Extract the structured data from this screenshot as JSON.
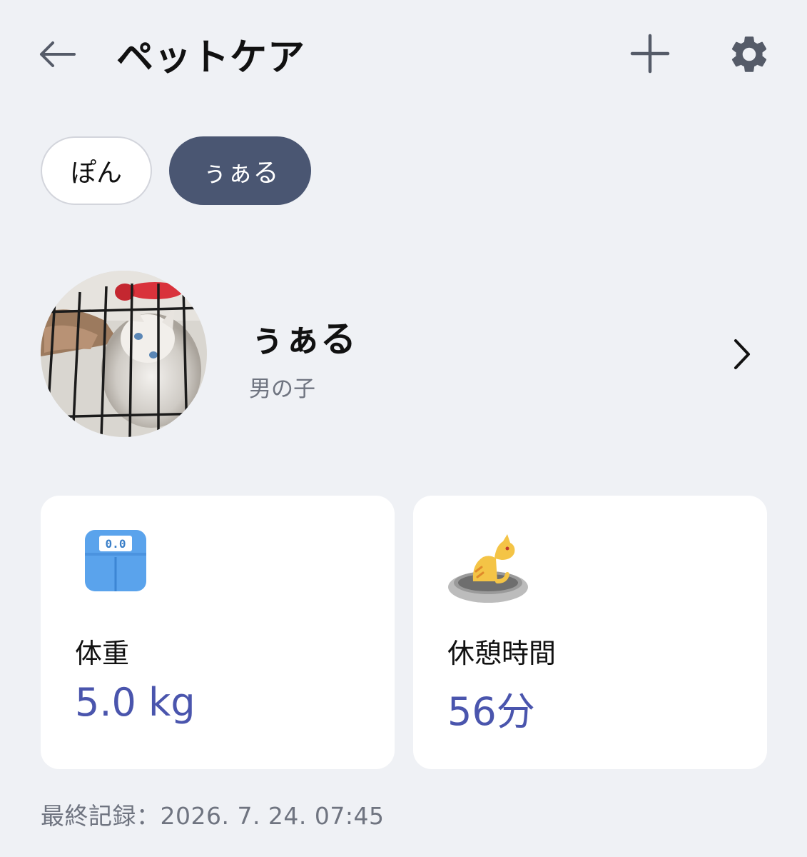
{
  "header": {
    "title": "ペットケア",
    "back_icon": "arrow-left-icon",
    "add_icon": "plus-icon",
    "settings_icon": "gear-icon"
  },
  "pet_tabs": [
    {
      "label": "ぽん",
      "selected": false
    },
    {
      "label": "ぅぁる",
      "selected": true
    }
  ],
  "profile": {
    "name": "ぅぁる",
    "sex": "男の子",
    "photo": "kitten-behind-cage-photo",
    "chevron_icon": "chevron-right-icon"
  },
  "cards": {
    "weight": {
      "icon": "scale-icon",
      "label": "体重",
      "value": "5.0 kg"
    },
    "rest": {
      "icon": "cat-in-bed-icon",
      "label": "休憩時間",
      "value": "56分"
    }
  },
  "last_record": "最終記録：2026. 7. 24. 07:45",
  "colors": {
    "background": "#eff1f5",
    "accent_dark": "#4a5672",
    "value_blue": "#4a55ad",
    "muted_text": "#6f7480"
  }
}
